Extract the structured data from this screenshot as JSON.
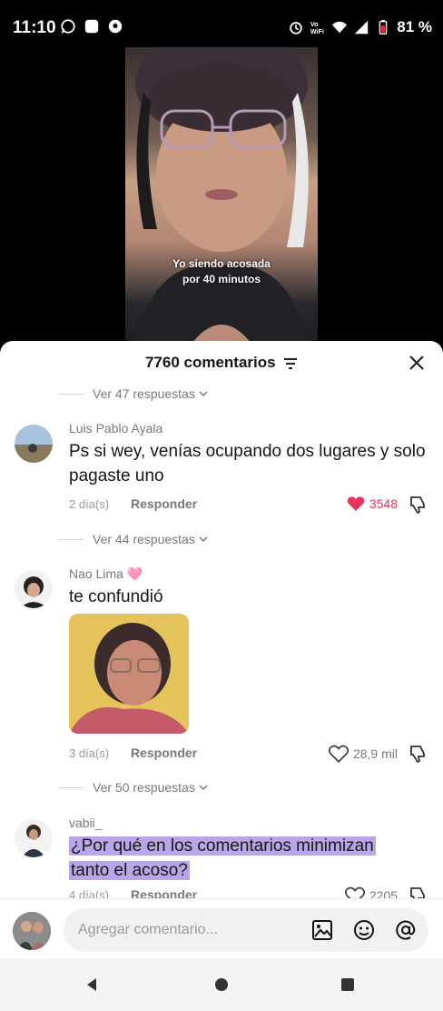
{
  "status_bar": {
    "time": "11:10",
    "battery": "81 %",
    "left_icons": [
      "whatsapp-icon",
      "app-icon",
      "soccer-ball-icon"
    ],
    "right_icons": [
      "alarm-icon",
      "vowifi-icon",
      "wifi-icon",
      "signal-icon",
      "battery-icon"
    ]
  },
  "video": {
    "caption_line1": "Yo siendo acosada",
    "caption_line2": "por 40 minutos"
  },
  "sheet": {
    "title": "7760 comentarios",
    "filter_icon": "filter-icon",
    "close_icon": "close-icon"
  },
  "replies": [
    {
      "label": "Ver 47 respuestas"
    },
    {
      "label": "Ver 44 respuestas"
    },
    {
      "label": "Ver 50 respuestas"
    }
  ],
  "comments": [
    {
      "username": "Luis Pablo Ayala",
      "text": "Ps si wey, venías ocupando dos lugares y solo pagaste uno",
      "time": "2 día(s)",
      "reply_label": "Responder",
      "likes": "3548",
      "liked": true
    },
    {
      "username": "Nao Lima 🩷",
      "text": "te confundió",
      "time": "3 día(s)",
      "reply_label": "Responder",
      "likes": "28,9 mil",
      "liked": false
    },
    {
      "username": "vabii_",
      "text_line1": "¿Por qué en los comentarios minimizan",
      "text_line2": "tanto el acoso?",
      "time": "4 día(s)",
      "reply_label": "Responder",
      "likes": "2205",
      "liked": false
    }
  ],
  "input": {
    "placeholder": "Agregar comentario...",
    "icons": [
      "image-icon",
      "emoji-sticker-icon",
      "mention-icon"
    ]
  },
  "colors": {
    "like_red": "#e8345a",
    "highlight_purple": "#b9a6e8",
    "sheet_bg": "#ffffff"
  }
}
